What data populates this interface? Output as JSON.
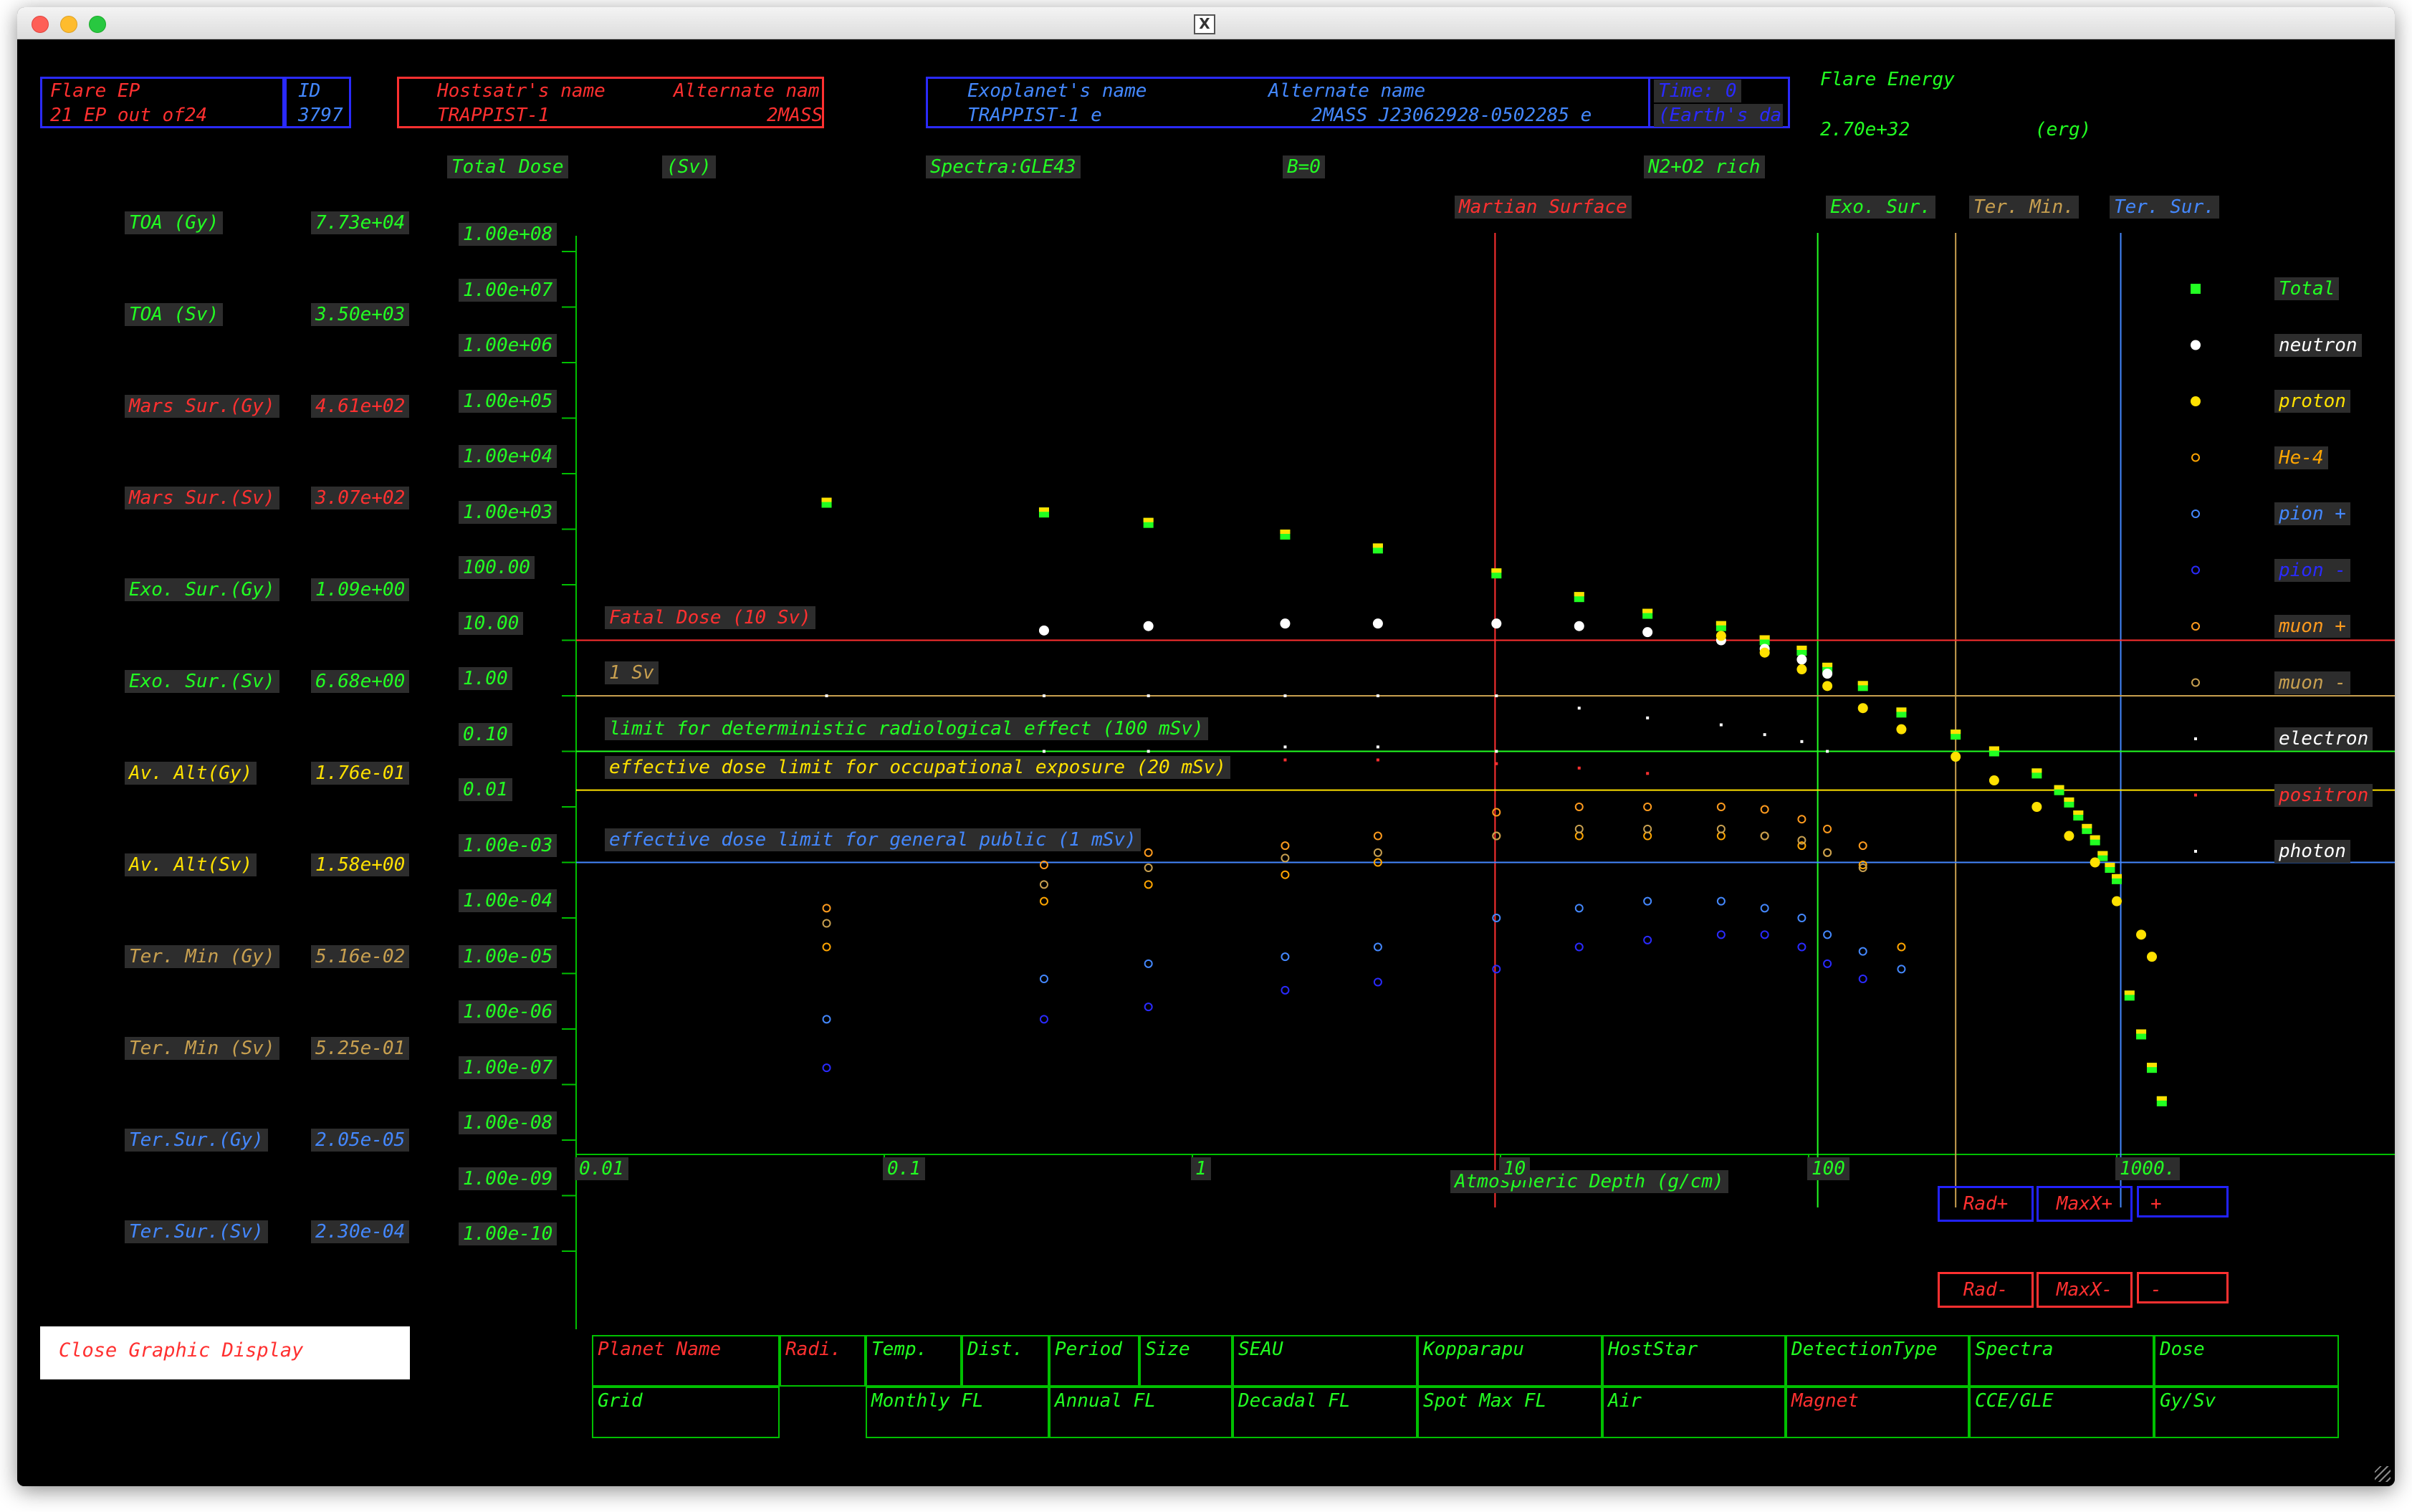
{
  "window": {
    "title_icon": "x11-icon"
  },
  "colors": {
    "green": "#22ff22",
    "red": "#ff3030",
    "blue": "#4488ff",
    "yellow": "#ffe100",
    "orange": "#ff9b1e",
    "brown": "#c8a050",
    "white": "#ffffff",
    "darkblue": "#2a2aff"
  },
  "header": {
    "flare_ep_label": "Flare EP",
    "flare_ep_value": "21  EP out of24",
    "id_label": "ID",
    "id_value": "3797",
    "hoststar_label": "Hostsatr's name",
    "hoststar_alt_label": "Alternate nam",
    "hoststar_value": "TRAPPIST-1",
    "hoststar_alt_value": "2MASS",
    "exoplanet_label": "Exoplanet's name",
    "exoplanet_alt_label": "Alternate name",
    "exoplanet_value": "TRAPPIST-1 e",
    "exoplanet_alt_value": "2MASS J23062928-0502285 e",
    "time_label": "Time: 0",
    "earth_label": "(Earth's da",
    "flare_energy_label": "Flare Energy",
    "flare_energy_value": "2.70e+32",
    "flare_energy_unit": "(erg)"
  },
  "subheader": {
    "total_dose": "Total Dose",
    "unit": "(Sv)",
    "spectra": "Spectra:GLE43",
    "b_field": "B=0",
    "atmosphere": "N2+O2 rich"
  },
  "readouts": [
    {
      "label": "TOA (Gy)",
      "value": "7.73e+04",
      "color": "#22ff22"
    },
    {
      "label": "TOA (Sv)",
      "value": "3.50e+03",
      "color": "#22ff22"
    },
    {
      "label": "Mars Sur.(Gy)",
      "value": "4.61e+02",
      "color": "#ff3030"
    },
    {
      "label": "Mars Sur.(Sv)",
      "value": "3.07e+02",
      "color": "#ff3030"
    },
    {
      "label": "Exo. Sur.(Gy)",
      "value": "1.09e+00",
      "color": "#22ff22"
    },
    {
      "label": "Exo. Sur.(Sv)",
      "value": "6.68e+00",
      "color": "#22ff22"
    },
    {
      "label": "Av. Alt(Gy)",
      "value": "1.76e-01",
      "color": "#ffe100"
    },
    {
      "label": "Av. Alt(Sv)",
      "value": "1.58e+00",
      "color": "#ffe100"
    },
    {
      "label": "Ter. Min (Gy)",
      "value": "5.16e-02",
      "color": "#c8a050"
    },
    {
      "label": "Ter. Min (Sv)",
      "value": "5.25e-01",
      "color": "#c8a050"
    },
    {
      "label": "Ter.Sur.(Gy)",
      "value": "2.05e-05",
      "color": "#4488ff"
    },
    {
      "label": "Ter.Sur.(Sv)",
      "value": "2.30e-04",
      "color": "#4488ff"
    }
  ],
  "close_button": "Close Graphic Display",
  "plot": {
    "vlines": [
      {
        "label": "Martian Surface",
        "x": 9.6,
        "color": "#ff3030"
      },
      {
        "label": "Exo. Sur.",
        "x": 107,
        "color": "#22ff22"
      },
      {
        "label": "Ter. Min.",
        "x": 300,
        "color": "#c8a050"
      },
      {
        "label": "Ter. Sur.",
        "x": 1030,
        "color": "#4488ff"
      }
    ],
    "hlines": [
      {
        "label": "Fatal Dose (10 Sv)",
        "y": 10,
        "color": "#ff3030"
      },
      {
        "label": "1 Sv",
        "y": 1,
        "color": "#c8a050"
      },
      {
        "label": "limit for deterministic radiological effect (100 mSv)",
        "y": 0.1,
        "color": "#22ff22"
      },
      {
        "label": "effective dose limit for occupational exposure (20 mSv)",
        "y": 0.02,
        "color": "#ffe100"
      },
      {
        "label": "effective dose limit for general public (1 mSv)",
        "y": 0.001,
        "color": "#4488ff"
      }
    ],
    "xlabel": "Atmospheric Depth (g/cm)"
  },
  "chart_data": {
    "type": "scatter",
    "title": "",
    "xlabel": "Atmospheric Depth (g/cm)",
    "ylabel": "Total Dose (Sv)",
    "x_scale": "log",
    "y_scale": "log",
    "xlim": [
      0.01,
      2000
    ],
    "ylim": [
      1e-10,
      100000000.0
    ],
    "x_ticks": [
      "0.01",
      "0.1",
      "1",
      "10",
      "100",
      "1000."
    ],
    "y_ticks": [
      "1.00e+08",
      "1.00e+07",
      "1.00e+06",
      "1.00e+05",
      "1.00e+04",
      "1.00e+03",
      "100.00",
      "10.00",
      "1.00",
      "0.10",
      "0.01",
      "1.00e-03",
      "1.00e-04",
      "1.00e-05",
      "1.00e-06",
      "1.00e-07",
      "1.00e-08",
      "1.00e-09",
      "1.00e-10"
    ],
    "legend": "right",
    "series": [
      {
        "name": "Total",
        "color": "#22ff22",
        "marker": "square",
        "x": [
          0.065,
          0.33,
          0.72,
          2.0,
          4.0,
          9.7,
          18,
          30,
          52,
          72,
          95,
          115,
          150,
          200,
          300,
          400,
          550,
          650,
          700,
          750,
          800,
          850,
          900,
          950,
          1000,
          1100,
          1200,
          1300,
          1400
        ],
        "y": [
          3000,
          2000,
          1300,
          800,
          450,
          160,
          60,
          30,
          18,
          10,
          6.5,
          3.2,
          1.5,
          0.5,
          0.2,
          0.1,
          0.04,
          0.02,
          0.012,
          0.007,
          0.004,
          0.0025,
          0.0013,
          0.0008,
          0.0005,
          4e-06,
          8e-07,
          2e-07,
          5e-08
        ]
      },
      {
        "name": "neutron",
        "color": "#ffffff",
        "marker": "dot",
        "x": [
          0.33,
          0.72,
          2.0,
          4.0,
          9.7,
          18,
          30,
          52,
          72,
          95,
          115
        ],
        "y": [
          15,
          18,
          20,
          20,
          20,
          18,
          14,
          10,
          7,
          4.5,
          2.5
        ]
      },
      {
        "name": "proton",
        "color": "#ffe100",
        "marker": "dot",
        "x": [
          52,
          72,
          95,
          115,
          150,
          200,
          300,
          400,
          550,
          700,
          850,
          1000,
          1200,
          1300
        ],
        "y": [
          12,
          6,
          3,
          1.5,
          0.6,
          0.25,
          0.08,
          0.03,
          0.01,
          0.003,
          0.001,
          0.0002,
          5e-05,
          2e-05
        ]
      },
      {
        "name": "He-4",
        "color": "#ffa500",
        "marker": "circle",
        "x": [
          0.065,
          0.33,
          0.72,
          2.0,
          4.0,
          9.7,
          18,
          30,
          52,
          72,
          95,
          115,
          150,
          200
        ],
        "y": [
          3e-05,
          0.0002,
          0.0004,
          0.0006,
          0.001,
          0.003,
          0.003,
          0.003,
          0.003,
          0.003,
          0.002,
          0.0015,
          0.0009,
          3e-05
        ]
      },
      {
        "name": "pion +",
        "color": "#4488ff",
        "marker": "circle",
        "x": [
          0.065,
          0.33,
          0.72,
          2.0,
          4.0,
          9.7,
          18,
          30,
          52,
          72,
          95,
          115,
          150,
          200
        ],
        "y": [
          1.5e-06,
          8e-06,
          1.5e-05,
          2e-05,
          3e-05,
          0.0001,
          0.00015,
          0.0002,
          0.0002,
          0.00015,
          0.0001,
          5e-05,
          2.5e-05,
          1.2e-05
        ]
      },
      {
        "name": "pion -",
        "color": "#2a2aff",
        "marker": "circle",
        "x": [
          0.065,
          0.33,
          0.72,
          2.0,
          4.0,
          9.7,
          18,
          30,
          52,
          72,
          95,
          115,
          150
        ],
        "y": [
          2e-07,
          1.5e-06,
          2.5e-06,
          5e-06,
          7e-06,
          1.2e-05,
          3e-05,
          4e-05,
          5e-05,
          5e-05,
          3e-05,
          1.5e-05,
          8e-06
        ]
      },
      {
        "name": "muon +",
        "color": "#ff9b1e",
        "marker": "circle",
        "x": [
          0.065,
          0.33,
          0.72,
          2.0,
          4.0,
          9.7,
          18,
          30,
          52,
          72,
          95,
          115,
          150
        ],
        "y": [
          0.00015,
          0.0009,
          0.0015,
          0.002,
          0.003,
          0.008,
          0.01,
          0.01,
          0.01,
          0.009,
          0.006,
          0.004,
          0.002
        ]
      },
      {
        "name": "muon -",
        "color": "#c8a050",
        "marker": "circle",
        "x": [
          0.065,
          0.33,
          0.72,
          2.0,
          4.0,
          9.7,
          18,
          30,
          52,
          72,
          95,
          115,
          150
        ],
        "y": [
          8e-05,
          0.0004,
          0.0008,
          0.0012,
          0.0015,
          0.003,
          0.004,
          0.004,
          0.004,
          0.003,
          0.0025,
          0.0015,
          0.0008
        ]
      },
      {
        "name": "electron",
        "color": "#ffffff",
        "marker": "pixel",
        "x": [
          0.065,
          0.33,
          0.72,
          2.0,
          4.0,
          9.7,
          18,
          30,
          52,
          72,
          95,
          115
        ],
        "y": [
          1,
          1,
          1,
          1,
          1,
          1,
          0.6,
          0.4,
          0.3,
          0.2,
          0.15,
          0.1
        ]
      },
      {
        "name": "positron",
        "color": "#ff3030",
        "marker": "pixel",
        "x": [
          0.33,
          0.72,
          2.0,
          4.0,
          9.7,
          18,
          30
        ],
        "y": [
          0.05,
          0.06,
          0.07,
          0.07,
          0.06,
          0.05,
          0.04
        ]
      },
      {
        "name": "photon",
        "color": "#ffffff",
        "marker": "pixel",
        "x": [
          0.33,
          0.72,
          2.0,
          4.0,
          9.7
        ],
        "y": [
          0.1,
          0.1,
          0.12,
          0.12,
          0.1
        ]
      }
    ]
  },
  "buttons": {
    "rad_plus": "Rad+",
    "maxx_plus": "MaxX+",
    "plus": "+",
    "rad_minus": "Rad-",
    "maxx_minus": "MaxX-",
    "minus": "-"
  },
  "menu_row1": [
    "Planet Name",
    "Radi.",
    "Temp.",
    "Dist.",
    "Period",
    "Size",
    "SEAU",
    "Kopparapu",
    "HostStar",
    "DetectionType",
    "Spectra",
    "Dose"
  ],
  "menu_row2": [
    "Grid",
    "",
    "Monthly FL",
    "Annual FL",
    "Decadal FL",
    "Spot Max FL",
    "Air",
    "Magnet",
    "CCE/GLE",
    "Gy/Sv"
  ]
}
